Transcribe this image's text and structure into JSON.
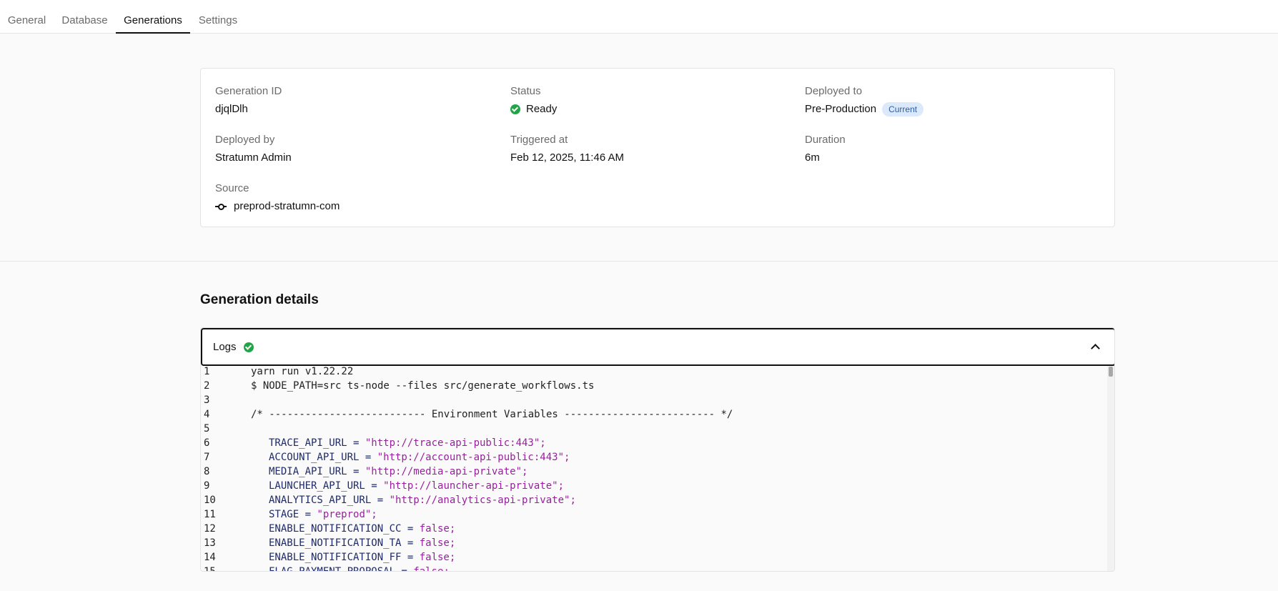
{
  "tabs": [
    {
      "label": "General"
    },
    {
      "label": "Database"
    },
    {
      "label": "Generations"
    },
    {
      "label": "Settings"
    }
  ],
  "summary": {
    "generation_id": {
      "label": "Generation ID",
      "value": "djqlDlh"
    },
    "status": {
      "label": "Status",
      "value": "Ready",
      "color": "#22a447"
    },
    "deployed_to": {
      "label": "Deployed to",
      "value": "Pre-Production",
      "badge": "Current"
    },
    "deployed_by": {
      "label": "Deployed by",
      "value": "Stratumn Admin"
    },
    "triggered_at": {
      "label": "Triggered at",
      "value": "Feb 12, 2025, 11:46 AM"
    },
    "duration": {
      "label": "Duration",
      "value": "6m"
    },
    "source": {
      "label": "Source",
      "value": "preprod-stratumn-com",
      "icon": "git-commit-icon"
    }
  },
  "details": {
    "title": "Generation details",
    "logs": {
      "label": "Logs",
      "status_icon": "check-circle-icon",
      "toggle_icon": "chevron-up-icon",
      "lines": [
        {
          "n": "1",
          "text": "yarn run v1.22.22"
        },
        {
          "n": "2",
          "text": "$ NODE_PATH=src ts-node --files src/generate_workflows.ts"
        },
        {
          "n": "3",
          "text": ""
        },
        {
          "n": "4",
          "text": "/* -------------------------- Environment Variables ------------------------- */"
        },
        {
          "n": "5",
          "text": ""
        },
        {
          "n": "6",
          "key": "TRACE_API_URL = ",
          "val": "\"http://trace-api-public:443\";"
        },
        {
          "n": "7",
          "key": "ACCOUNT_API_URL = ",
          "val": "\"http://account-api-public:443\";"
        },
        {
          "n": "8",
          "key": "MEDIA_API_URL = ",
          "val": "\"http://media-api-private\";"
        },
        {
          "n": "9",
          "key": "LAUNCHER_API_URL = ",
          "val": "\"http://launcher-api-private\";"
        },
        {
          "n": "10",
          "key": "ANALYTICS_API_URL = ",
          "val": "\"http://analytics-api-private\";"
        },
        {
          "n": "11",
          "key": "STAGE = ",
          "val": "\"preprod\";"
        },
        {
          "n": "12",
          "key": "ENABLE_NOTIFICATION_CC = ",
          "val": "false;"
        },
        {
          "n": "13",
          "key": "ENABLE_NOTIFICATION_TA = ",
          "val": "false;"
        },
        {
          "n": "14",
          "key": "ENABLE_NOTIFICATION_FF = ",
          "val": "false;"
        },
        {
          "n": "15",
          "key": "FLAG_PAYMENT_PROPOSAL = ",
          "val": "false;"
        }
      ]
    }
  }
}
